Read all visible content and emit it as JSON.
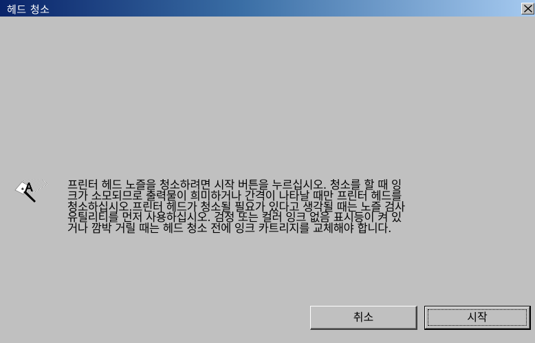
{
  "window": {
    "title": "헤드 청소",
    "close_glyph": "✕"
  },
  "icon": {
    "name": "printer-info-icon"
  },
  "message": {
    "lines": [
      "프린터 헤드 노즐을 청소하려면 시작 버튼을 누르십시오. 청소를 할 때 잉",
      "크가 소모되므로 출력물이 희미하거나 간격이 나타날 때만 프린터 헤드를",
      "청소하십시오.프린터 헤드가 청소될 필요가 있다고 생각될 때는 노즐 검사",
      "유틸리티를 먼저 사용하십시오. 검정 또는 컬러 잉크 없음 표시등이 켜 있",
      "거나 깜박 거릴 때는 헤드 청소 전에 잉크 카트리지를 교체해야 합니다."
    ]
  },
  "buttons": {
    "cancel_label": "취소",
    "start_label": "시작"
  },
  "colors": {
    "background": "#c0c0c0",
    "titlebar_start": "#0a246a",
    "titlebar_end": "#a6caf0",
    "text": "#000000"
  }
}
